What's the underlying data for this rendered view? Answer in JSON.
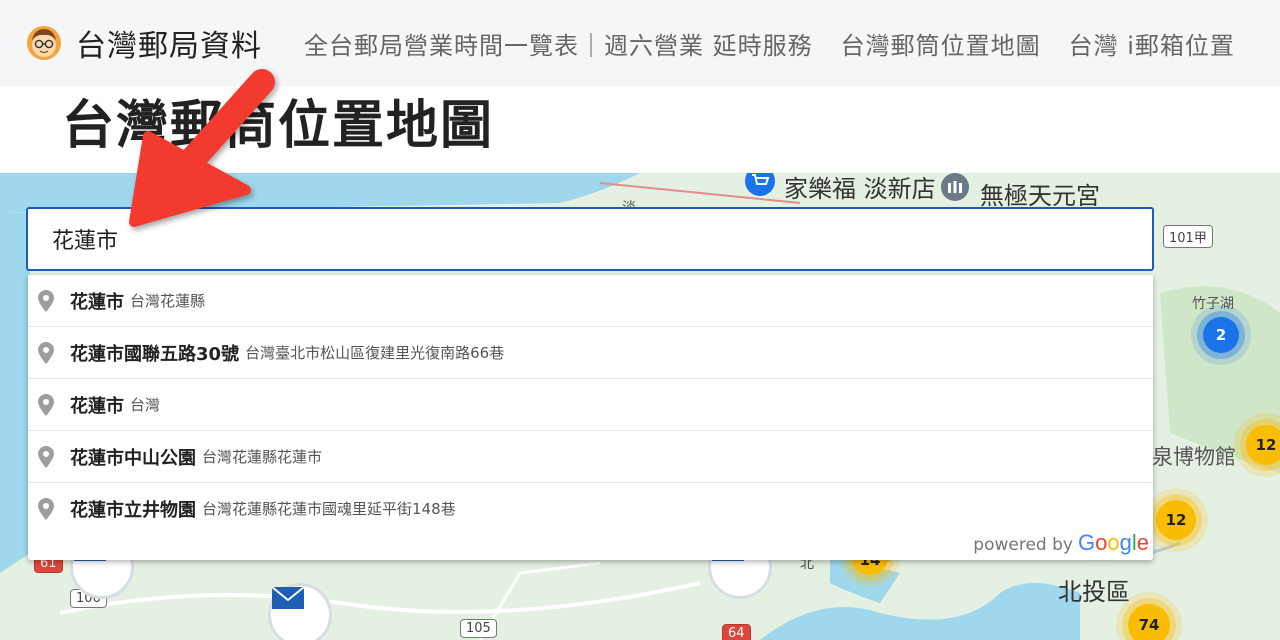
{
  "nav": {
    "site_name": "台灣郵局資料",
    "links": [
      "全台郵局營業時間一覽表｜週六營業 延時服務",
      "台灣郵筒位置地圖",
      "台灣 i郵箱位置"
    ]
  },
  "page": {
    "title": "台灣郵筒位置地圖"
  },
  "search": {
    "value": "花蓮市"
  },
  "suggestions": [
    {
      "main": "花蓮市",
      "secondary": "台灣花蓮縣"
    },
    {
      "main": "花蓮市國聯五路30號",
      "secondary": "台灣臺北市松山區復建里光復南路66巷"
    },
    {
      "main": "花蓮市",
      "secondary": "台灣"
    },
    {
      "main": "花蓮市中山公園",
      "secondary": "台灣花蓮縣花蓮市"
    },
    {
      "main": "花蓮市立井物園",
      "secondary": "台灣花蓮縣花蓮市國魂里延平街148巷"
    }
  ],
  "powered_by": {
    "text": "powered by",
    "brand": [
      "G",
      "o",
      "o",
      "g",
      "l",
      "e"
    ],
    "brand_colors": [
      "#4285F4",
      "#EA4335",
      "#FBBC05",
      "#4285F4",
      "#34A853",
      "#EA4335"
    ]
  },
  "map": {
    "labels": {
      "carrefour": "家樂福 淡新店",
      "temple": "無極天元宮",
      "bamboo_lake": "竹子湖",
      "museum": "泉博物館",
      "beitou": "北投區",
      "tam": "淡",
      "bei": "北"
    },
    "road_shields": {
      "r101a": "101甲",
      "r106": "106",
      "r105": "105",
      "r64": "64",
      "r61": "61"
    },
    "clusters": {
      "c2": "2",
      "c12a": "12",
      "c12b": "12",
      "c14": "14",
      "c74": "74"
    }
  },
  "colors": {
    "accent": "#1c5bc1",
    "arrow": "#f23b2f",
    "water": "#9fd7ec",
    "land": "#e4f0e2"
  }
}
